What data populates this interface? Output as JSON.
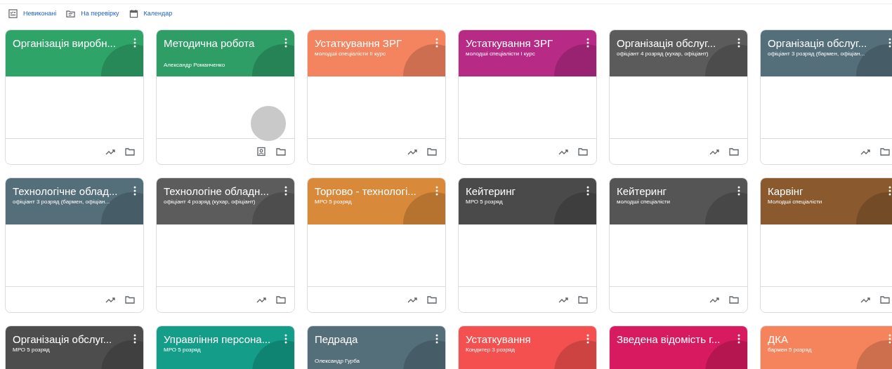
{
  "top_links": [
    {
      "label": "Невиконані",
      "kind": "todo"
    },
    {
      "label": "На перевірку",
      "kind": "review"
    },
    {
      "label": "Календар",
      "kind": "calendar"
    }
  ],
  "cards": [
    {
      "title": "Організація виробн...",
      "color": "#2fa468",
      "kind": "enrolled",
      "avatar": false
    },
    {
      "title": "Методична робота",
      "owner": "Александр Романченко",
      "color": "#2e9d66",
      "kind": "teaching",
      "avatar": true
    },
    {
      "title": "Устаткування ЗРГ",
      "subtitle": "молодші спеціалісти ІІ курс",
      "color": "#f4845f",
      "kind": "enrolled",
      "avatar": false
    },
    {
      "title": "Устаткування ЗРГ",
      "subtitle": "молодші спеціалісти І курс",
      "color": "#b72a86",
      "kind": "enrolled",
      "avatar": false
    },
    {
      "title": "Організація обслуг...",
      "subtitle": "офіціант 4 розряд (кухар, офіціант)",
      "color": "#5b5b5b",
      "kind": "enrolled",
      "avatar": false
    },
    {
      "title": "Організація обслуг...",
      "subtitle": "офіціант 3 розряд (бармен, офіціан...",
      "color": "#546e7a",
      "kind": "enrolled",
      "avatar": false
    },
    {
      "title": "Технологічне облад...",
      "subtitle": "офіціант 3 розряд (бармен, офіціан...",
      "color": "#546e7a",
      "kind": "enrolled",
      "avatar": false
    },
    {
      "title": "Технологіне обладн...",
      "subtitle": "офіціант 4 розряд (кухар, офіціант)",
      "color": "#5c5c5c",
      "kind": "enrolled",
      "avatar": false
    },
    {
      "title": "Торгово - технологі...",
      "subtitle": "МРО 5 розряд",
      "color": "#d9893a",
      "kind": "enrolled",
      "avatar": false
    },
    {
      "title": "Кейтеринг",
      "subtitle": "МРО 5 розряд",
      "color": "#4a4a4a",
      "kind": "enrolled",
      "avatar": false
    },
    {
      "title": "Кейтеринг",
      "subtitle": "молодші спеціалісти",
      "color": "#555555",
      "kind": "enrolled",
      "avatar": false
    },
    {
      "title": "Карвінг",
      "subtitle": "Молодші спеціалісти",
      "color": "#8a5a2e",
      "kind": "enrolled",
      "avatar": false
    },
    {
      "title": "Організація обслуг...",
      "subtitle": "МРО 5 розряд",
      "color": "#4d4d4d",
      "kind": "enrolled",
      "avatar": false
    },
    {
      "title": "Управління персона...",
      "subtitle": "МРО 5 розряд",
      "color": "#149e8a",
      "kind": "enrolled",
      "avatar": false
    },
    {
      "title": "Педрада",
      "owner": "Олександр Гурба",
      "color": "#546e7a",
      "kind": "enrolled",
      "avatar": false
    },
    {
      "title": "Устаткування",
      "subtitle": "Кондитер 3 розряд",
      "color": "#f4504f",
      "kind": "enrolled",
      "avatar": false
    },
    {
      "title": "Зведена відомість г...",
      "color": "#d81b60",
      "kind": "enrolled",
      "avatar": false
    },
    {
      "title": "ДКА",
      "subtitle": "бармен 5 розряд",
      "color": "#f5845c",
      "kind": "enrolled",
      "avatar": false
    }
  ]
}
